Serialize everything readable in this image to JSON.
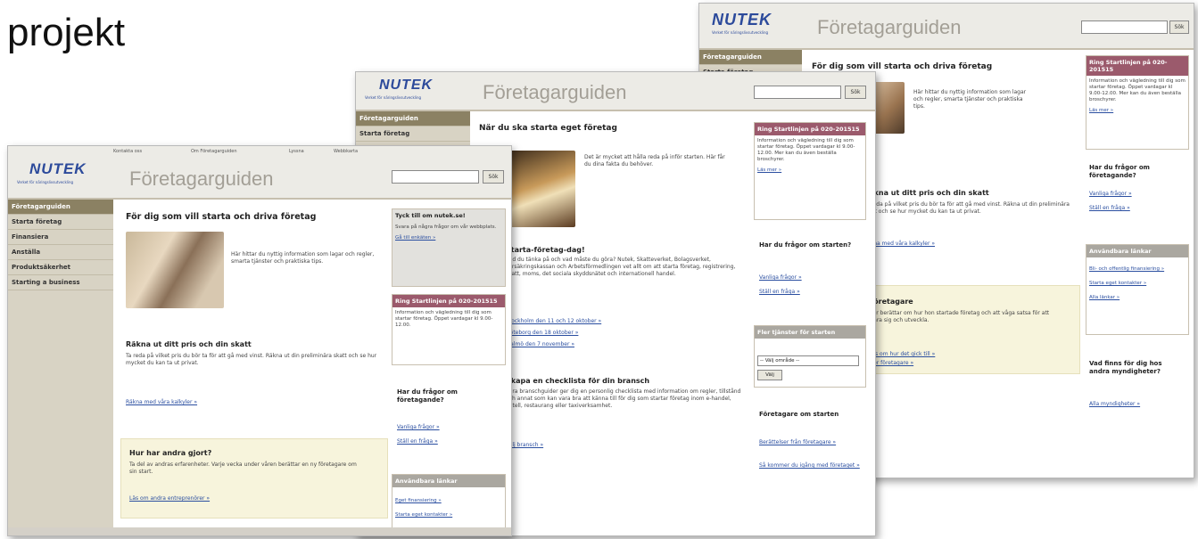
{
  "slide": {
    "title": "projekt"
  },
  "site": {
    "logo": "NUTEK",
    "logo_tagline": "Verket för näringslivsutveckling",
    "brand": "Företagarguiden",
    "search_button": "Sök",
    "topnav": [
      "Kontakta oss",
      "Om Företagarguiden",
      "Lyssna",
      "Webbkarta"
    ]
  },
  "shot_back": {
    "nav_items": [
      "Företagarguiden",
      "Starta företag"
    ],
    "heading": "För dig som vill starta och driva företag",
    "intro": "Här hittar du nyttig information som lagar och regler, smarta tjänster och praktiska tips.",
    "section2_title": "Räkna ut ditt pris och din skatt",
    "section2_text": "Ta reda på vilket pris du bör ta för att gå med vinst. Räkna ut din preliminära skatt och se hur mycket du kan ta ut privat.",
    "section2_link": "Räkna med våra kalkyler »",
    "section3_title": "Företagare",
    "section3_text": "Här berättar om hur hon startade företag och att våga satsa för att klara sig och utveckla.",
    "section3_link": "Läs om hur det gick till »",
    "section3_link2": "Fler företagare »",
    "right_box_head": "Ring Startlinjen på 020-201515",
    "right_box_text": "Information och vägledning till dig som startar företag. Öppet vardagar kl 9.00-12.00. Mer kan du även beställa broschyrer.",
    "right_box_link": "Läs mer »",
    "q_head": "Har du frågor om företagande?",
    "q_link1": "Vanliga frågor »",
    "q_link2": "Ställ en fråga »",
    "grey_head": "Användbara länkar",
    "grey_links": [
      "Bli- och offentlig finansiering »",
      "Starta eget kontakter »",
      "Alla länkar »"
    ],
    "other_head": "Vad finns för dig hos andra myndigheter?",
    "other_link": "Alla myndigheter »"
  },
  "shot_mid": {
    "nav_items": [
      "Företagarguiden",
      "Starta företag"
    ],
    "heading": "När du ska starta eget företag",
    "intro": "Det är mycket att hålla reda på inför starten. Här får du dina fakta du behöver.",
    "section2_title": "Starta-företag-dag!",
    "section2_text": "Vad du tänka på och vad måste du göra? Nutek, Skatteverket, Bolagsverket, Försäkringskassan och Arbetsförmedlingen vet allt om att starta företag, registrering, skatt, moms, det sociala skyddsnätet och internationell handel.",
    "section2_links": [
      "Stockholm den 11 och 12 oktober »",
      "Göteborg den 18 oktober »",
      "Malmö den 7 november »"
    ],
    "section3_title": "Skapa en checklista för din bransch",
    "section3_text": "Våra branschguider ger dig en personlig checklista med information om regler, tillstånd och annat som kan vara bra att känna till för dig som startar företag inom e-handel, hotell, restaurang eller taxiverksamhet.",
    "section3_link": "Välj bransch »",
    "right_box_head": "Ring Startlinjen på 020-201515",
    "right_box_text": "Information och vägledning till dig som startar företag. Öppet vardagar kl 9.00-12.00. Mer kan du även beställa broschyrer.",
    "right_box_link": "Läs mer »",
    "q_head": "Har du frågor om starten?",
    "q_link1": "Vanliga frågor »",
    "q_link2": "Ställ en fråga »",
    "grey_head": "Fler tjänster för starten",
    "select_value": "-- Välj område --",
    "select_button": "Välj",
    "more_head": "Företagare om starten",
    "more_links": [
      "Berättelser från företagare »",
      "Så kommer du igång med företaget »"
    ]
  },
  "shot_front": {
    "nav_items": [
      "Företagarguiden",
      "Starta företag",
      "Finansiera",
      "Anställa",
      "Produktsäkerhet",
      "Starting a business"
    ],
    "heading": "För dig som vill starta och driva företag",
    "intro": "Här hittar du nyttig information som lagar och regler, smarta tjänster och praktiska tips.",
    "section2_title": "Räkna ut ditt pris och din skatt",
    "section2_text": "Ta reda på vilket pris du bör ta för att gå med vinst. Räkna ut din preliminära skatt och se hur mycket du kan ta ut privat.",
    "section2_link": "Räkna med våra kalkyler »",
    "section3_title": "Hur har andra gjort?",
    "section3_text": "Ta del av andras erfarenheter. Varje vecka under våren berättar en ny företagare om sin start.",
    "section3_link": "Läs om andra entreprenörer »",
    "feedback_head": "Tyck till om nutek.se!",
    "feedback_text": "Svara på några frågor om vår webbplats.",
    "feedback_link": "Gå till enkäten »",
    "right_box_head": "Ring Startlinjen på 020-201515",
    "right_box_text": "Information och vägledning till dig som startar företag. Öppet vardagar kl 9.00-12.00.",
    "q_head": "Har du frågor om företagande?",
    "q_link1": "Vanliga frågor »",
    "q_link2": "Ställ en fråga »",
    "grey_head": "Användbara länkar",
    "grey_links": [
      "Eget finansiering »",
      "Starta eget kontakter »"
    ]
  },
  "colors": {
    "nutek_blue": "#2c4a9b",
    "accent_red": "#9b5a6c",
    "nav_active": "#8b8163",
    "link": "#2a4ea0"
  }
}
